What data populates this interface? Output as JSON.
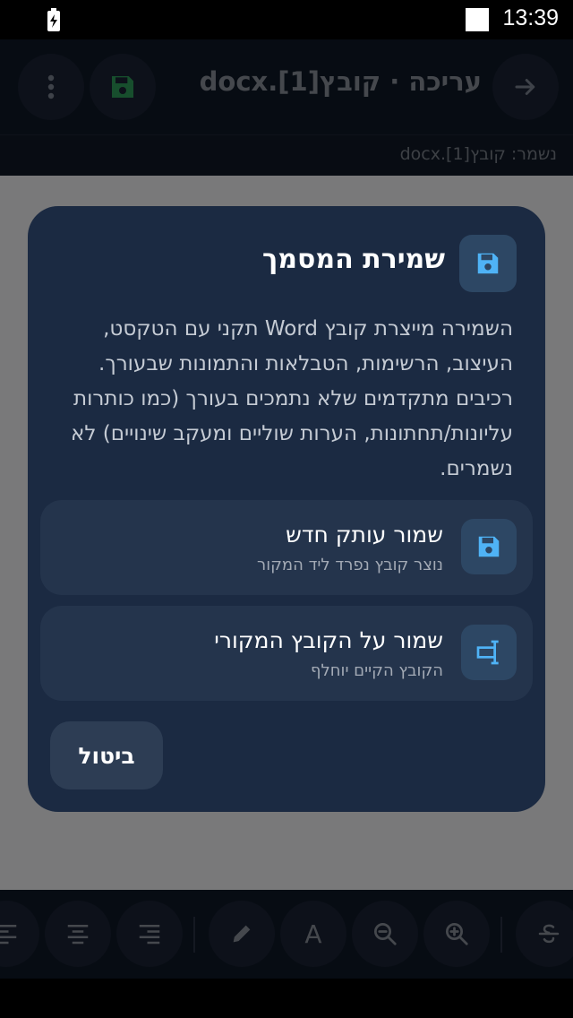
{
  "status_bar": {
    "time": "13:39"
  },
  "app_bar": {
    "title": "עריכה · קובץ[1].docx",
    "icons": {
      "back": "arrow-right-icon",
      "save": "save-icon",
      "menu": "more-vertical-icon"
    }
  },
  "sub_bar": {
    "text": "נשמר: קובץ[1].docx"
  },
  "dialog": {
    "title": "שמירת המסמך",
    "body": "השמירה מייצרת קובץ Word תקני עם הטקסט, העיצוב, הרשימות, הטבלאות והתמונות שבעורך. רכיבים מתקדמים שלא נתמכים בעורך (כמו כותרות עליונות/תחתונות, הערות שוליים ומעקב שינויים) לא נשמרים.",
    "options": [
      {
        "title": "שמור עותק חדש",
        "subtitle": "נוצר קובץ נפרד ליד המקור",
        "icon": "save-icon"
      },
      {
        "title": "שמור על הקובץ המקורי",
        "subtitle": "הקובץ הקיים יוחלף",
        "icon": "replace-file-icon"
      }
    ],
    "cancel_label": "ביטול"
  },
  "toolbar": {
    "items": [
      "align-left-icon",
      "align-center-icon",
      "align-right-icon",
      "pen-icon",
      "font-icon",
      "zoom-out-icon",
      "zoom-in-icon",
      "strikethrough-icon"
    ],
    "font_glyph": "A"
  },
  "colors": {
    "accent": "#4fb3f6",
    "dialog_bg": "#1b2a42",
    "option_bg": "#24344c",
    "save_green": "#2e9d5a"
  }
}
